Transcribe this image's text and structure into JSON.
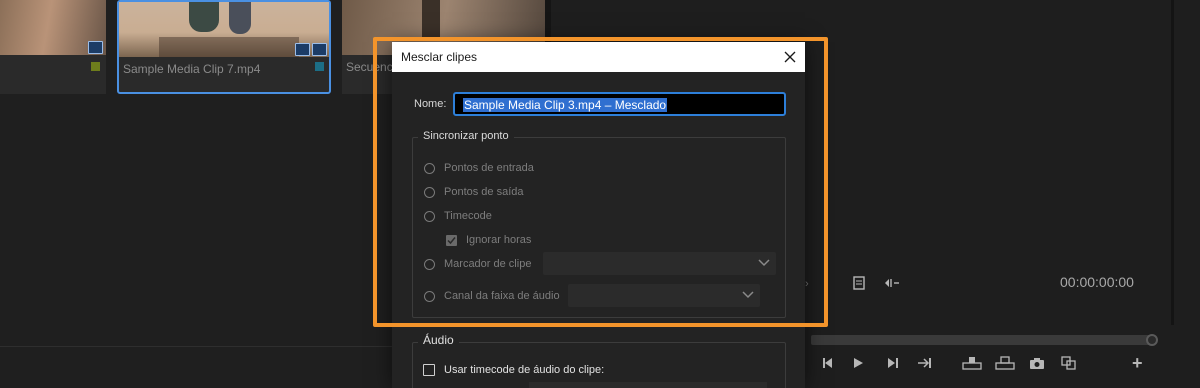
{
  "bin": {
    "clips": [
      {
        "label": "",
        "tag_color": "#6e7d1c"
      },
      {
        "label": "Sample Media Clip 7.mp4",
        "tag_color": "#1c6e86",
        "selected": true
      },
      {
        "label": "Secuencia"
      }
    ]
  },
  "monitor": {
    "timecode": "00:00:00:00",
    "icons": [
      "export-frame-icon",
      "insert-icon",
      "step-back-icon",
      "play-icon",
      "step-forward-icon",
      "go-to-out-icon",
      "lift-icon",
      "extract-icon",
      "camera-icon",
      "comparison-icon",
      "add-button-icon"
    ]
  },
  "dialog": {
    "title": "Mesclar clipes",
    "name_label": "Nome:",
    "name_value": "Sample Media Clip 3.mp4 – Mesclado",
    "sync_group_label": "Sincronizar ponto",
    "options": {
      "in_points": "Pontos de entrada",
      "out_points": "Pontos de saída",
      "timecode": "Timecode",
      "ignore_hours": "Ignorar horas",
      "clip_marker": "Marcador de clipe",
      "audio_channel": "Canal da faixa de áudio"
    },
    "audio_group_label": "Áudio",
    "use_audio_timecode": "Usar timecode de áudio do clipe:"
  },
  "colors": {
    "highlight": "#f3942b",
    "accent": "#2d7fd9"
  }
}
